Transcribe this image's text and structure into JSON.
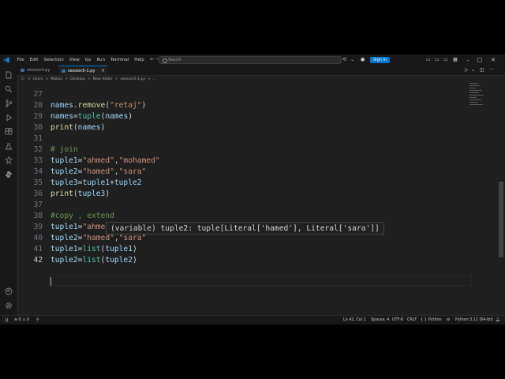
{
  "titlebar": {
    "menu": [
      "File",
      "Edit",
      "Selection",
      "View",
      "Go",
      "Run",
      "Terminal",
      "Help"
    ],
    "search_placeholder": "Search",
    "signin_label": "Sign in"
  },
  "tabs": [
    {
      "label": "session3.py",
      "active": false
    },
    {
      "label": "session5-1.py",
      "active": true
    }
  ],
  "breadcrumb": [
    "C:",
    ">",
    "Users",
    ">",
    "Makka",
    ">",
    "Desktop",
    ">",
    "New folder",
    ">",
    "session5-1.py",
    ">",
    "..."
  ],
  "editor": {
    "line_numbers": [
      "27",
      "28",
      "29",
      "30",
      "31",
      "32",
      "33",
      "34",
      "35",
      "36",
      "37",
      "38",
      "39",
      "40",
      "41",
      "42"
    ],
    "current_line": "42",
    "hover_tooltip": "(variable) tuple2: tuple[Literal['hamed'], Literal['sara']]"
  },
  "status": {
    "problems": "⊗ 0 ⚠ 0",
    "position": "Ln 42, Col 1",
    "spaces": "Spaces: 4",
    "encoding": "UTF-8",
    "eol": "CRLF",
    "braces": "{ }",
    "language": "Python",
    "interpreter": "Python 3.11 (64-bit)"
  },
  "colors": {
    "accent": "#0078d4",
    "editor_bg": "#1f1f1f",
    "chrome_bg": "#181818"
  }
}
